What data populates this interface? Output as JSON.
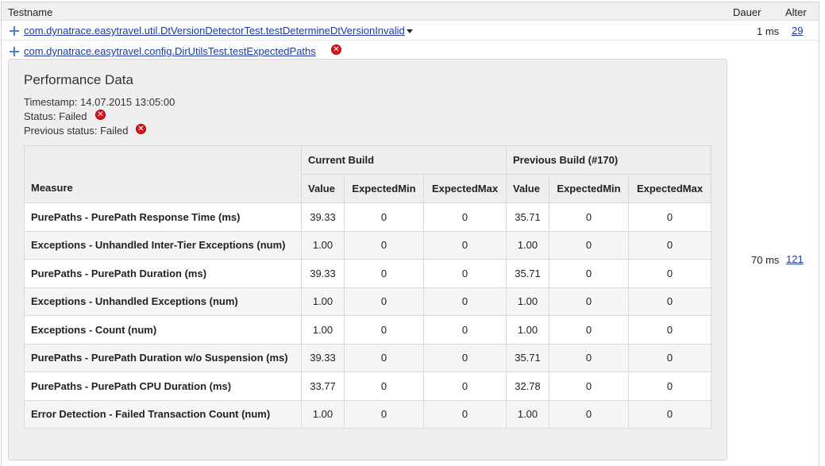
{
  "header": {
    "testname": "Testname",
    "dauer": "Dauer",
    "alter": "Alter"
  },
  "tests": [
    {
      "name": "com.dynatrace.easytravel.util.DtVersionDetectorTest.testDetermineDtVersionInvalid",
      "dauer": "1 ms",
      "alter": "29"
    },
    {
      "name": "com.dynatrace.easytravel.config.DirUtilsTest.testExpectedPaths",
      "dauer": "70 ms",
      "alter": "121",
      "status_icon": "fail-x-icon"
    }
  ],
  "performance": {
    "title": "Performance Data",
    "timestamp": "Timestamp: 14.07.2015 13:05:00",
    "status": "Status: Failed",
    "previous_status": "Previous status: Failed",
    "columns": {
      "measure": "Measure",
      "current_build": "Current Build",
      "previous_build": "Previous Build (#170)",
      "value": "Value",
      "expected_min": "ExpectedMin",
      "expected_max": "ExpectedMax"
    },
    "rows": [
      {
        "measure": "PurePaths - PurePath Response Time (ms)",
        "cur": "39.33",
        "cur_min": "0",
        "cur_max": "0",
        "prev": "35.71",
        "prev_min": "0",
        "prev_max": "0"
      },
      {
        "measure": "Exceptions - Unhandled Inter-Tier Exceptions (num)",
        "cur": "1.00",
        "cur_min": "0",
        "cur_max": "0",
        "prev": "1.00",
        "prev_min": "0",
        "prev_max": "0"
      },
      {
        "measure": "PurePaths - PurePath Duration (ms)",
        "cur": "39.33",
        "cur_min": "0",
        "cur_max": "0",
        "prev": "35.71",
        "prev_min": "0",
        "prev_max": "0"
      },
      {
        "measure": "Exceptions - Unhandled Exceptions (num)",
        "cur": "1.00",
        "cur_min": "0",
        "cur_max": "0",
        "prev": "1.00",
        "prev_min": "0",
        "prev_max": "0"
      },
      {
        "measure": "Exceptions - Count (num)",
        "cur": "1.00",
        "cur_min": "0",
        "cur_max": "0",
        "prev": "1.00",
        "prev_min": "0",
        "prev_max": "0"
      },
      {
        "measure": "PurePaths - PurePath Duration w/o Suspension (ms)",
        "cur": "39.33",
        "cur_min": "0",
        "cur_max": "0",
        "prev": "35.71",
        "prev_min": "0",
        "prev_max": "0"
      },
      {
        "measure": "PurePaths - PurePath CPU Duration (ms)",
        "cur": "33.77",
        "cur_min": "0",
        "cur_max": "0",
        "prev": "32.78",
        "prev_min": "0",
        "prev_max": "0"
      },
      {
        "measure": "Error Detection - Failed Transaction Count (num)",
        "cur": "1.00",
        "cur_min": "0",
        "cur_max": "0",
        "prev": "1.00",
        "prev_min": "0",
        "prev_max": "0"
      }
    ]
  },
  "colors": {
    "link": "#1a3a9c",
    "expand_icon": "#4a82c3",
    "fail": "#d8141c"
  }
}
